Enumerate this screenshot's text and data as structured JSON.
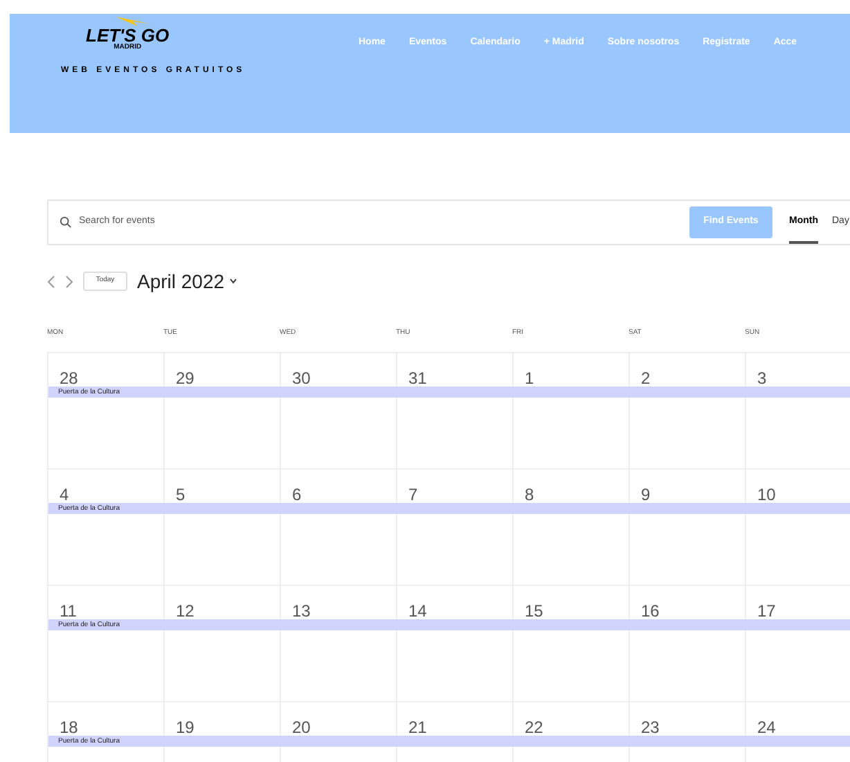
{
  "header": {
    "logo": {
      "text": "LET'S GO",
      "subtext": "MADRID"
    },
    "tagline": "WEB EVENTOS GRATUITOS",
    "nav": [
      "Home",
      "Eventos",
      "Calendario",
      "+ Madrid",
      "Sobre nosotros",
      "Registrate",
      "Acce"
    ]
  },
  "search": {
    "placeholder": "Search for events",
    "button": "Find Events"
  },
  "views": [
    {
      "label": "Month",
      "selected": true
    },
    {
      "label": "Day",
      "selected": false
    }
  ],
  "calendar": {
    "today": "Today",
    "month": "April 2022",
    "weekdays": [
      "MON",
      "TUE",
      "WED",
      "THU",
      "FRI",
      "SAT",
      "SUN"
    ],
    "weeks": [
      {
        "days": [
          "28",
          "29",
          "30",
          "31",
          "1",
          "2",
          "3"
        ],
        "event": "Puerta de la Cultura"
      },
      {
        "days": [
          "4",
          "5",
          "6",
          "7",
          "8",
          "9",
          "10"
        ],
        "event": "Puerta de la Cultura"
      },
      {
        "days": [
          "11",
          "12",
          "13",
          "14",
          "15",
          "16",
          "17"
        ],
        "event": "Puerta de la Cultura"
      },
      {
        "days": [
          "18",
          "19",
          "20",
          "21",
          "22",
          "23",
          "24"
        ],
        "event": "Puerta de la Cultura"
      }
    ]
  }
}
